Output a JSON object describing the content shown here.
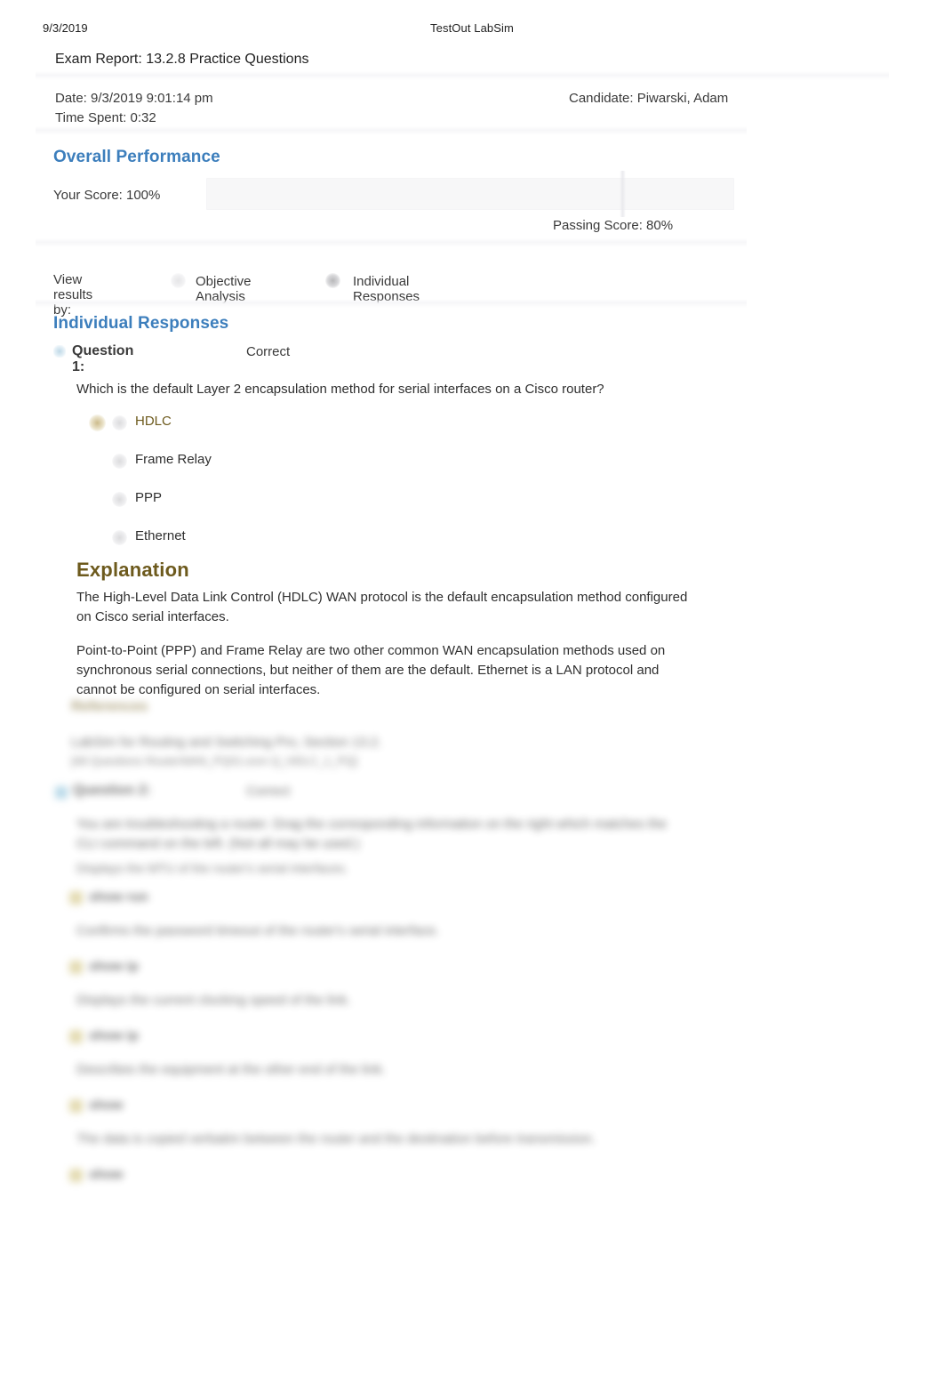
{
  "print_header": {
    "date": "9/3/2019",
    "app_title": "TestOut LabSim"
  },
  "report": {
    "title": "Exam Report: 13.2.8 Practice Questions",
    "date_label": "Date: 9/3/2019 9:01:14 pm",
    "time_spent_label": "Time Spent: 0:32",
    "candidate_label": "Candidate: Piwarski, Adam"
  },
  "overall": {
    "heading": "Overall Performance",
    "your_score_label": "Your Score: 100%",
    "your_score_percent": 100,
    "passing_score_label": "Passing Score: 80%",
    "passing_score_percent": 80
  },
  "view_results": {
    "label": "View results by:",
    "options": [
      {
        "label": "Objective Analysis",
        "selected": false
      },
      {
        "label": "Individual Responses",
        "selected": true
      }
    ]
  },
  "individual": {
    "heading": "Individual Responses"
  },
  "question1": {
    "number_label": "Question 1:",
    "status": "Correct",
    "prompt": "Which is the default Layer 2 encapsulation method for serial interfaces on a Cisco router?",
    "options": [
      {
        "label": "HDLC",
        "selected": true,
        "correct": true
      },
      {
        "label": "Frame Relay",
        "selected": false,
        "correct": false
      },
      {
        "label": "PPP",
        "selected": false,
        "correct": false
      },
      {
        "label": "Ethernet",
        "selected": false,
        "correct": false
      }
    ],
    "explanation_heading": "Explanation",
    "explanation_paragraphs": [
      "The High-Level Data Link Control (HDLC) WAN protocol is the default encapsulation method configured on Cisco serial interfaces.",
      "Point-to-Point (PPP) and Frame Relay are two other common WAN encapsulation methods used on synchronous serial connections, but neither of them are the default. Ethernet is a LAN protocol and cannot be configured on serial interfaces."
    ],
    "references_heading": "References",
    "reference_line1": "LabSim for Routing and Switching Pro, Section 13.2.",
    "reference_line2": "[All Questions RouterWAN_PQ01.exm Q_HDLC_1_PQ]"
  },
  "question2": {
    "number_label": "Question 2:",
    "status": "Correct",
    "prompt": "You are troubleshooting a router. Drag the corresponding information on the right which matches the CLI command on the left. (Not all may be used.)",
    "subprompt": "Displays the MTU of the router's serial interfaces.",
    "matches": [
      {
        "answer": "show run",
        "prompt": "Confirms the password timeout of the router's serial interface."
      },
      {
        "answer": "show ip",
        "prompt": "Displays the current clocking speed of the link."
      },
      {
        "answer": "show ip",
        "prompt": "Describes the equipment at the other end of the link."
      },
      {
        "answer": "show",
        "prompt": "The data is copied verbatim between the router and the destination before transmission."
      },
      {
        "answer": "show",
        "prompt": ""
      }
    ]
  }
}
